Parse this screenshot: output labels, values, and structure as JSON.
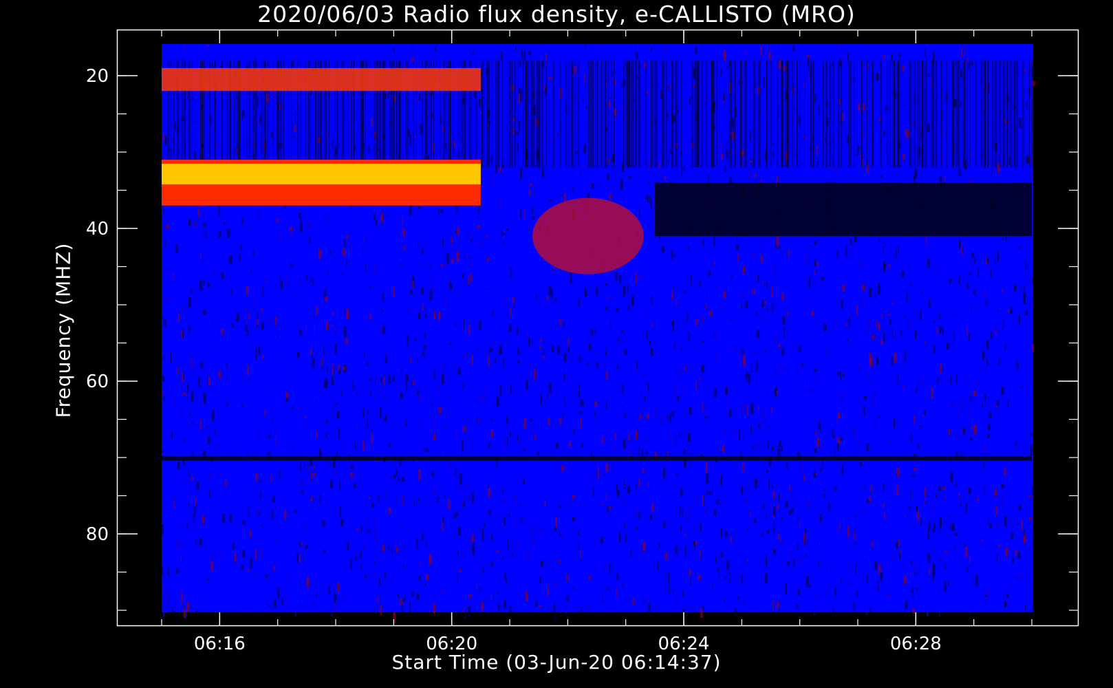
{
  "chart_data": {
    "type": "heatmap",
    "title": "2020/06/03  Radio flux density, e-CALLISTO (MRO)",
    "xlabel": "Start Time (03-Jun-20 06:14:37)",
    "ylabel": "Frequency (MHZ)",
    "x_range": [
      "06:14:37",
      "06:29:37"
    ],
    "xlim_minutes": [
      14.6,
      29.6
    ],
    "ylim": [
      16,
      90.5
    ],
    "y_inverted": true,
    "x_ticks": [
      "06:16",
      "06:20",
      "06:24",
      "06:28"
    ],
    "x_tick_minutes": [
      16,
      20,
      24,
      28
    ],
    "y_ticks": [
      20,
      40,
      60,
      80
    ],
    "colormap": [
      "#000000",
      "#0000ff",
      "#ff0000",
      "#ffff00"
    ],
    "background": "#0000ff",
    "features": [
      {
        "name": "band-20MHz",
        "t_start": 15.0,
        "t_end": 20.5,
        "f_low": 19,
        "f_high": 22,
        "intensity": "high"
      },
      {
        "name": "band-33MHz",
        "t_start": 15.0,
        "t_end": 20.5,
        "f_low": 31,
        "f_high": 37,
        "intensity": "very-high"
      },
      {
        "name": "burst-40MHz",
        "t_start": 21.2,
        "t_end": 23.5,
        "f_low": 36,
        "f_high": 46,
        "intensity": "medium"
      },
      {
        "name": "dark-band",
        "t_start": 23.5,
        "t_end": 30.0,
        "f_low": 34,
        "f_high": 41,
        "intensity": "low"
      },
      {
        "name": "line-70MHz",
        "t_start": 15.0,
        "t_end": 30.0,
        "f_low": 69.8,
        "f_high": 70.4,
        "intensity": "low"
      }
    ]
  }
}
